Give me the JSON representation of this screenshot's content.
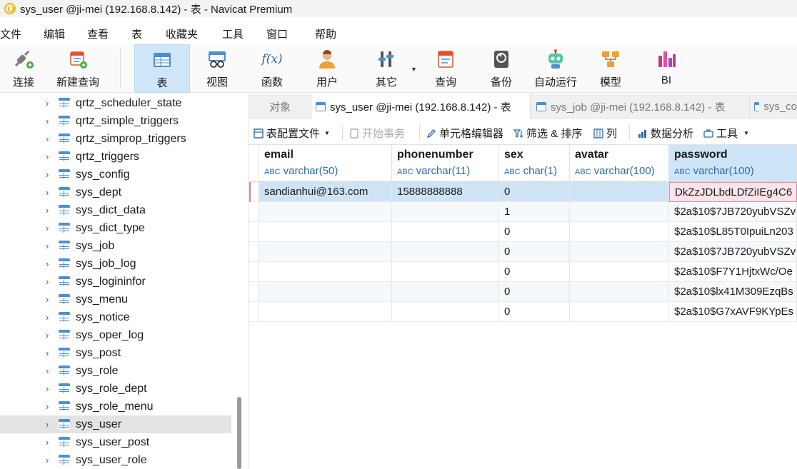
{
  "window": {
    "title": "sys_user @ji-mei (192.168.8.142) - 表 - Navicat Premium"
  },
  "menu": [
    "文件",
    "编辑",
    "查看",
    "表",
    "收藏夹",
    "工具",
    "窗口",
    "帮助"
  ],
  "toolbar": {
    "items": [
      {
        "label": "连接",
        "icon": "connect-icon"
      },
      {
        "label": "新建查询",
        "icon": "new-query-icon"
      },
      {
        "label": "表",
        "icon": "table-icon",
        "active": true
      },
      {
        "label": "视图",
        "icon": "view-icon"
      },
      {
        "label": "函数",
        "icon": "function-icon"
      },
      {
        "label": "用户",
        "icon": "user-icon"
      },
      {
        "label": "其它",
        "icon": "tools-icon"
      },
      {
        "label": "查询",
        "icon": "query-icon"
      },
      {
        "label": "备份",
        "icon": "backup-icon"
      },
      {
        "label": "自动运行",
        "icon": "robot-icon"
      },
      {
        "label": "模型",
        "icon": "model-icon"
      },
      {
        "label": "BI",
        "icon": "bi-icon"
      }
    ],
    "function_glyph": "f(x)"
  },
  "tree": {
    "items": [
      "qrtz_scheduler_state",
      "qrtz_simple_triggers",
      "qrtz_simprop_triggers",
      "qrtz_triggers",
      "sys_config",
      "sys_dept",
      "sys_dict_data",
      "sys_dict_type",
      "sys_job",
      "sys_job_log",
      "sys_logininfor",
      "sys_menu",
      "sys_notice",
      "sys_oper_log",
      "sys_post",
      "sys_role",
      "sys_role_dept",
      "sys_role_menu",
      "sys_user",
      "sys_user_post",
      "sys_user_role"
    ],
    "selected": "sys_user"
  },
  "tabs": {
    "objects": "对象",
    "active": "sys_user @ji-mei (192.168.8.142) - 表",
    "second": "sys_job @ji-mei (192.168.8.142) - 表",
    "third": "sys_co"
  },
  "subtoolbar": {
    "table_config": "表配置文件",
    "begin_transaction": "开始事务",
    "cell_editor": "单元格编辑器",
    "filter_sort": "筛选 & 排序",
    "columns": "列",
    "data_analysis": "数据分析",
    "tools": "工具"
  },
  "grid": {
    "type_glyph": "ABC",
    "columns": [
      {
        "name": "email",
        "type": "varchar(50)"
      },
      {
        "name": "phonenumber",
        "type": "varchar(11)"
      },
      {
        "name": "sex",
        "type": "char(1)"
      },
      {
        "name": "avatar",
        "type": "varchar(100)"
      },
      {
        "name": "password",
        "type": "varchar(100)"
      }
    ],
    "rows": [
      [
        "sandianhui@163.com",
        "15888888888",
        "0",
        "",
        "DkZzJDLbdLDfZiIEg4C6"
      ],
      [
        "",
        "",
        "1",
        "",
        "$2a$10$7JB720yubVSZv"
      ],
      [
        "",
        "",
        "0",
        "",
        "$2a$10$L85T0IpuiLn203"
      ],
      [
        "",
        "",
        "0",
        "",
        "$2a$10$7JB720yubVSZv"
      ],
      [
        "",
        "",
        "0",
        "",
        "$2a$10$F7Y1HjtxWc/Oe"
      ],
      [
        "",
        "",
        "0",
        "",
        "$2a$10$lx41M309EzqBs"
      ],
      [
        "",
        "",
        "0",
        "",
        "$2a$10$G7xAVF9KYpEs"
      ]
    ]
  },
  "colors": {
    "accent": "#4a8fd4",
    "selection": "#cfe3f6",
    "editing": "#fbe3ea"
  }
}
